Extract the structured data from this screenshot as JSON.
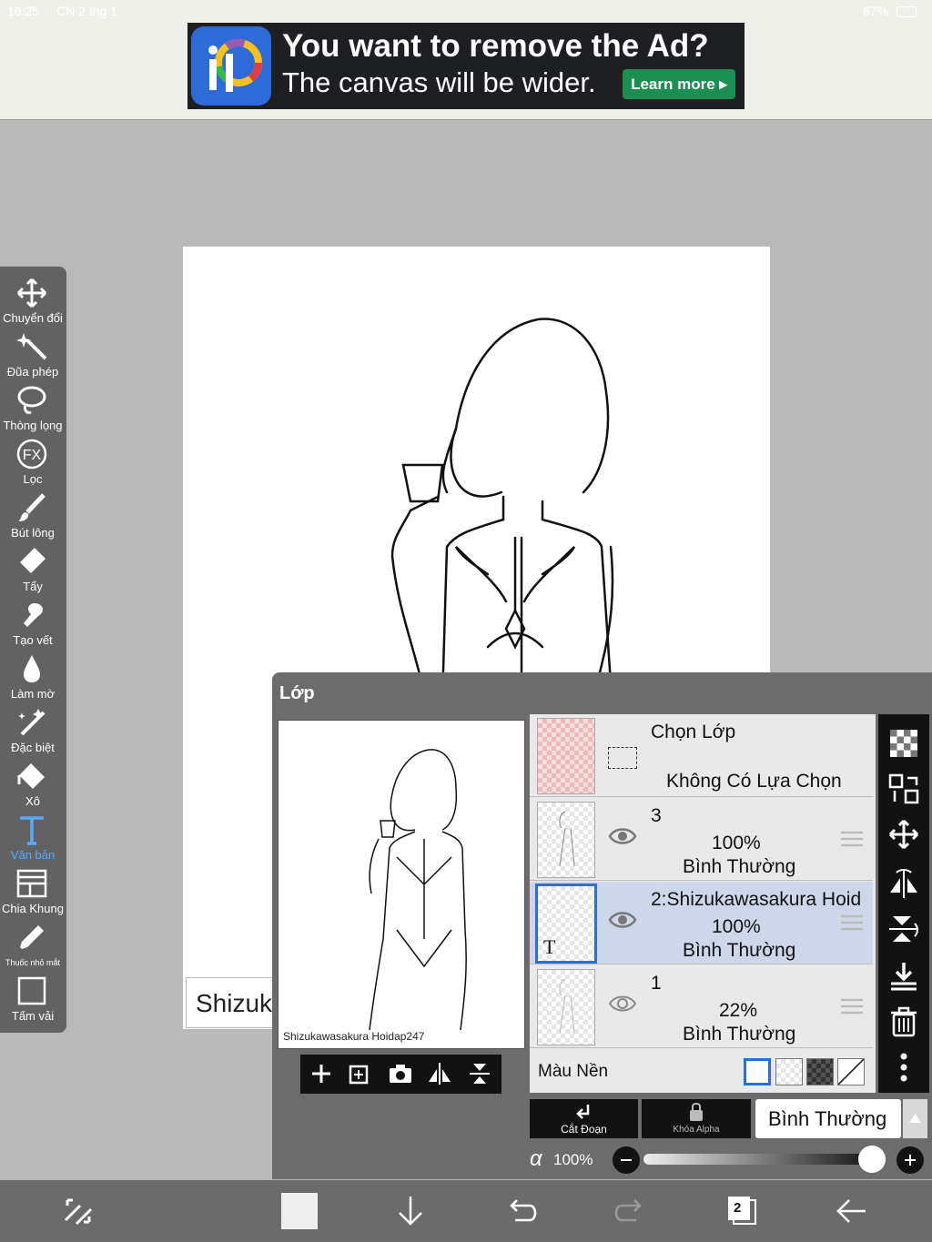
{
  "status": {
    "time": "16:25",
    "date": "CN 2 thg 1",
    "battery": "67%"
  },
  "ad": {
    "headline": "You want to remove the Ad?",
    "subline": "The canvas will be wider.",
    "button": "Learn more"
  },
  "canvas": {
    "text_layer_preview": "Shizuk"
  },
  "toolbar": {
    "items": [
      {
        "label": "Chuyển đổi",
        "icon": "move-icon"
      },
      {
        "label": "Đũa phép",
        "icon": "magic-wand-icon"
      },
      {
        "label": "Thòng lọng",
        "icon": "lasso-icon"
      },
      {
        "label": "Lọc",
        "icon": "fx-icon"
      },
      {
        "label": "Bút lông",
        "icon": "brush-icon"
      },
      {
        "label": "Tẩy",
        "icon": "eraser-icon"
      },
      {
        "label": "Tạo vết",
        "icon": "smudge-icon"
      },
      {
        "label": "Làm mờ",
        "icon": "blur-icon"
      },
      {
        "label": "Đặc biệt",
        "icon": "special-brush-icon"
      },
      {
        "label": "Xô",
        "icon": "bucket-icon"
      },
      {
        "label": "Văn bản",
        "icon": "text-icon",
        "active": true
      },
      {
        "label": "Chia Khung",
        "icon": "frame-divider-icon"
      },
      {
        "label": "Thuốc nhỏ mắt",
        "icon": "eyedropper-icon"
      },
      {
        "label": "Tấm vải",
        "icon": "canvas-icon"
      }
    ]
  },
  "layers_panel": {
    "title": "Lớp",
    "preview_caption": "Shizukawasakura Hoidap247",
    "selection_layer": {
      "title": "Chọn Lớp",
      "subtitle": "Không Có Lựa Chọn"
    },
    "layers": [
      {
        "name": "3",
        "opacity": "100%",
        "blend": "Bình Thường",
        "selected": false,
        "visible": true
      },
      {
        "name": "2:Shizukawasakura Hoid",
        "opacity": "100%",
        "blend": "Bình Thường",
        "selected": true,
        "visible": true,
        "thumb_glyph": "T"
      },
      {
        "name": "1",
        "opacity": "22%",
        "blend": "Bình Thường",
        "selected": false,
        "visible": true
      }
    ],
    "background_label": "Màu Nền",
    "clip_label": "Cắt Đoạn",
    "alpha_lock_label": "Khóa Alpha",
    "blend_mode": "Bình Thường",
    "alpha_symbol": "α",
    "opacity": "100%",
    "opacity_fraction": 1.0
  },
  "bottom_bar": {
    "page_count": "2"
  },
  "colors": {
    "accent": "#2a6fd6",
    "active_tool": "#5aa9ff",
    "ad_button": "#1b8e52"
  }
}
